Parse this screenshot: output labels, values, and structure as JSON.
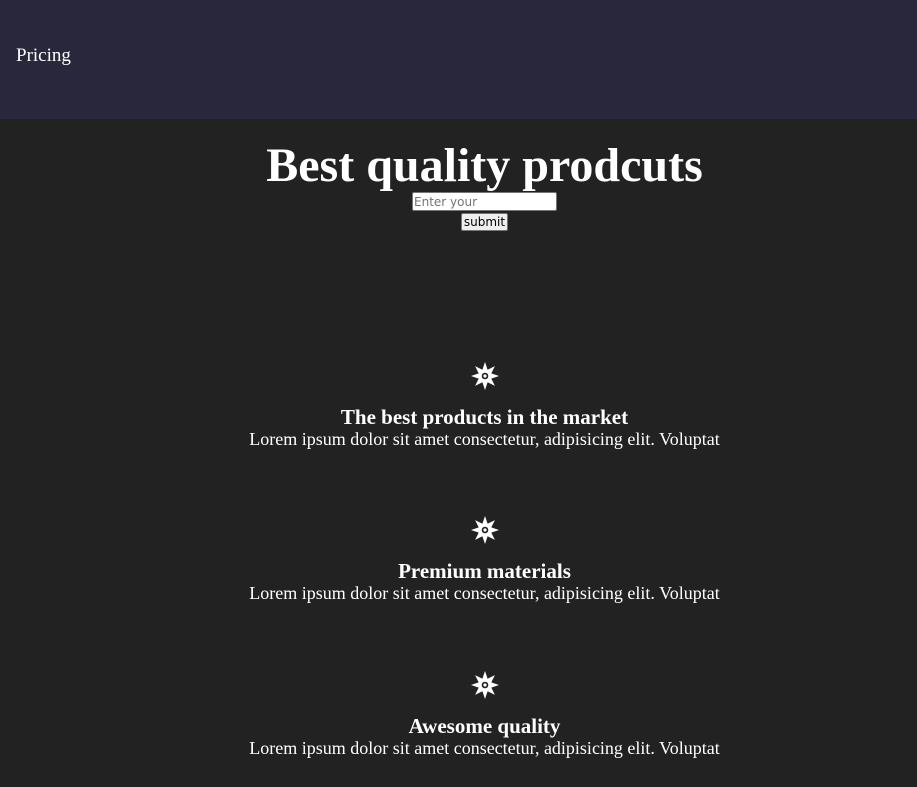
{
  "nav": {
    "links": [
      {
        "label": "Pricing"
      }
    ]
  },
  "hero": {
    "title": "Best quality prodcuts",
    "email_placeholder": "Enter your",
    "submit_label": "submit"
  },
  "features": [
    {
      "icon": "star-burst-icon",
      "title": "The best products in the market",
      "text": "Lorem ipsum dolor sit amet consectetur, adipisicing elit. Voluptat"
    },
    {
      "icon": "star-burst-icon",
      "title": "Premium materials",
      "text": "Lorem ipsum dolor sit amet consectetur, adipisicing elit. Voluptat"
    },
    {
      "icon": "star-burst-icon",
      "title": "Awesome quality",
      "text": "Lorem ipsum dolor sit amet consectetur, adipisicing elit. Voluptat"
    }
  ],
  "colors": {
    "page_background": "#222222",
    "navbar_background": "#28273b",
    "text": "#ffffff"
  }
}
